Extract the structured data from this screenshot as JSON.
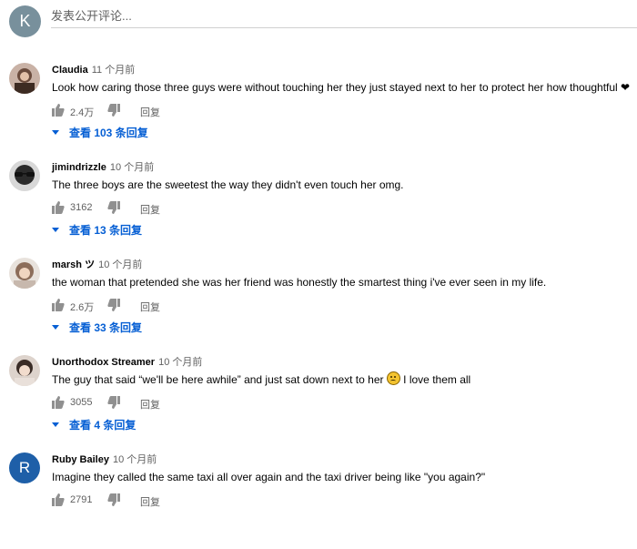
{
  "composer": {
    "avatar_letter": "K",
    "placeholder": "发表公开评论..."
  },
  "comments": [
    {
      "author": "Claudia",
      "time": "11 个月前",
      "text": "Look how caring those three guys were without touching her they just stayed next to her to protect her how thoughtful ❤",
      "likes": "2.4万",
      "reply_label": "回复",
      "replies_label": "查看 103 条回复"
    },
    {
      "author": "jimindrizzle",
      "time": "10 个月前",
      "text": "The three boys are the sweetest the way they didn't even touch her omg.",
      "likes": "3162",
      "reply_label": "回复",
      "replies_label": "查看 13 条回复"
    },
    {
      "author": "marsh ツ",
      "time": "10 个月前",
      "text": "the woman that pretended she was her friend was honestly the smartest thing i've ever seen in my life.",
      "likes": "2.6万",
      "reply_label": "回复",
      "replies_label": "查看 33 条回复"
    },
    {
      "author": "Unorthodox Streamer",
      "time": "10 个月前",
      "text": "The guy that said “we'll be here awhile” and just sat down next to her",
      "text_after_emoji": " I love them all",
      "likes": "3055",
      "reply_label": "回复",
      "replies_label": "查看 4 条回复"
    },
    {
      "author": "Ruby Bailey",
      "time": "10 个月前",
      "avatar_letter": "R",
      "text": "Imagine they called the same taxi all over again and the taxi driver being like \"you again?\"",
      "likes": "2791",
      "reply_label": "回复"
    }
  ],
  "colors": {
    "link_blue": "#065fd4",
    "meta_gray": "#606060",
    "avatar_k": "#78909c",
    "avatar_r": "#1e5fa8"
  }
}
